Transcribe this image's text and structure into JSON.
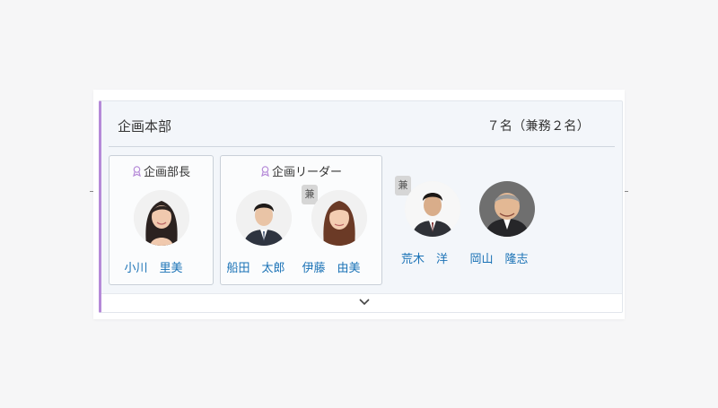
{
  "department": {
    "name": "企画本部",
    "count": "７名（兼務２名）"
  },
  "groups": [
    {
      "title": "企画部長",
      "icon": "award-icon",
      "members": [
        {
          "name": "小川　里美",
          "concurrent": false
        }
      ]
    },
    {
      "title": "企画リーダー",
      "icon": "award-icon",
      "members": [
        {
          "name": "船田　太郎",
          "concurrent": false
        },
        {
          "name": "伊藤　由美",
          "concurrent": true,
          "badge": "兼"
        }
      ]
    }
  ],
  "members": [
    {
      "name": "荒木　洋",
      "concurrent": true,
      "badge": "兼"
    },
    {
      "name": "岡山　隆志",
      "concurrent": false
    }
  ],
  "colors": {
    "accent": "#b58ad8",
    "name_link": "#1a72b6",
    "card_bg": "#f3f6fa"
  },
  "footer": {
    "expand_icon": "chevron-down-icon"
  }
}
